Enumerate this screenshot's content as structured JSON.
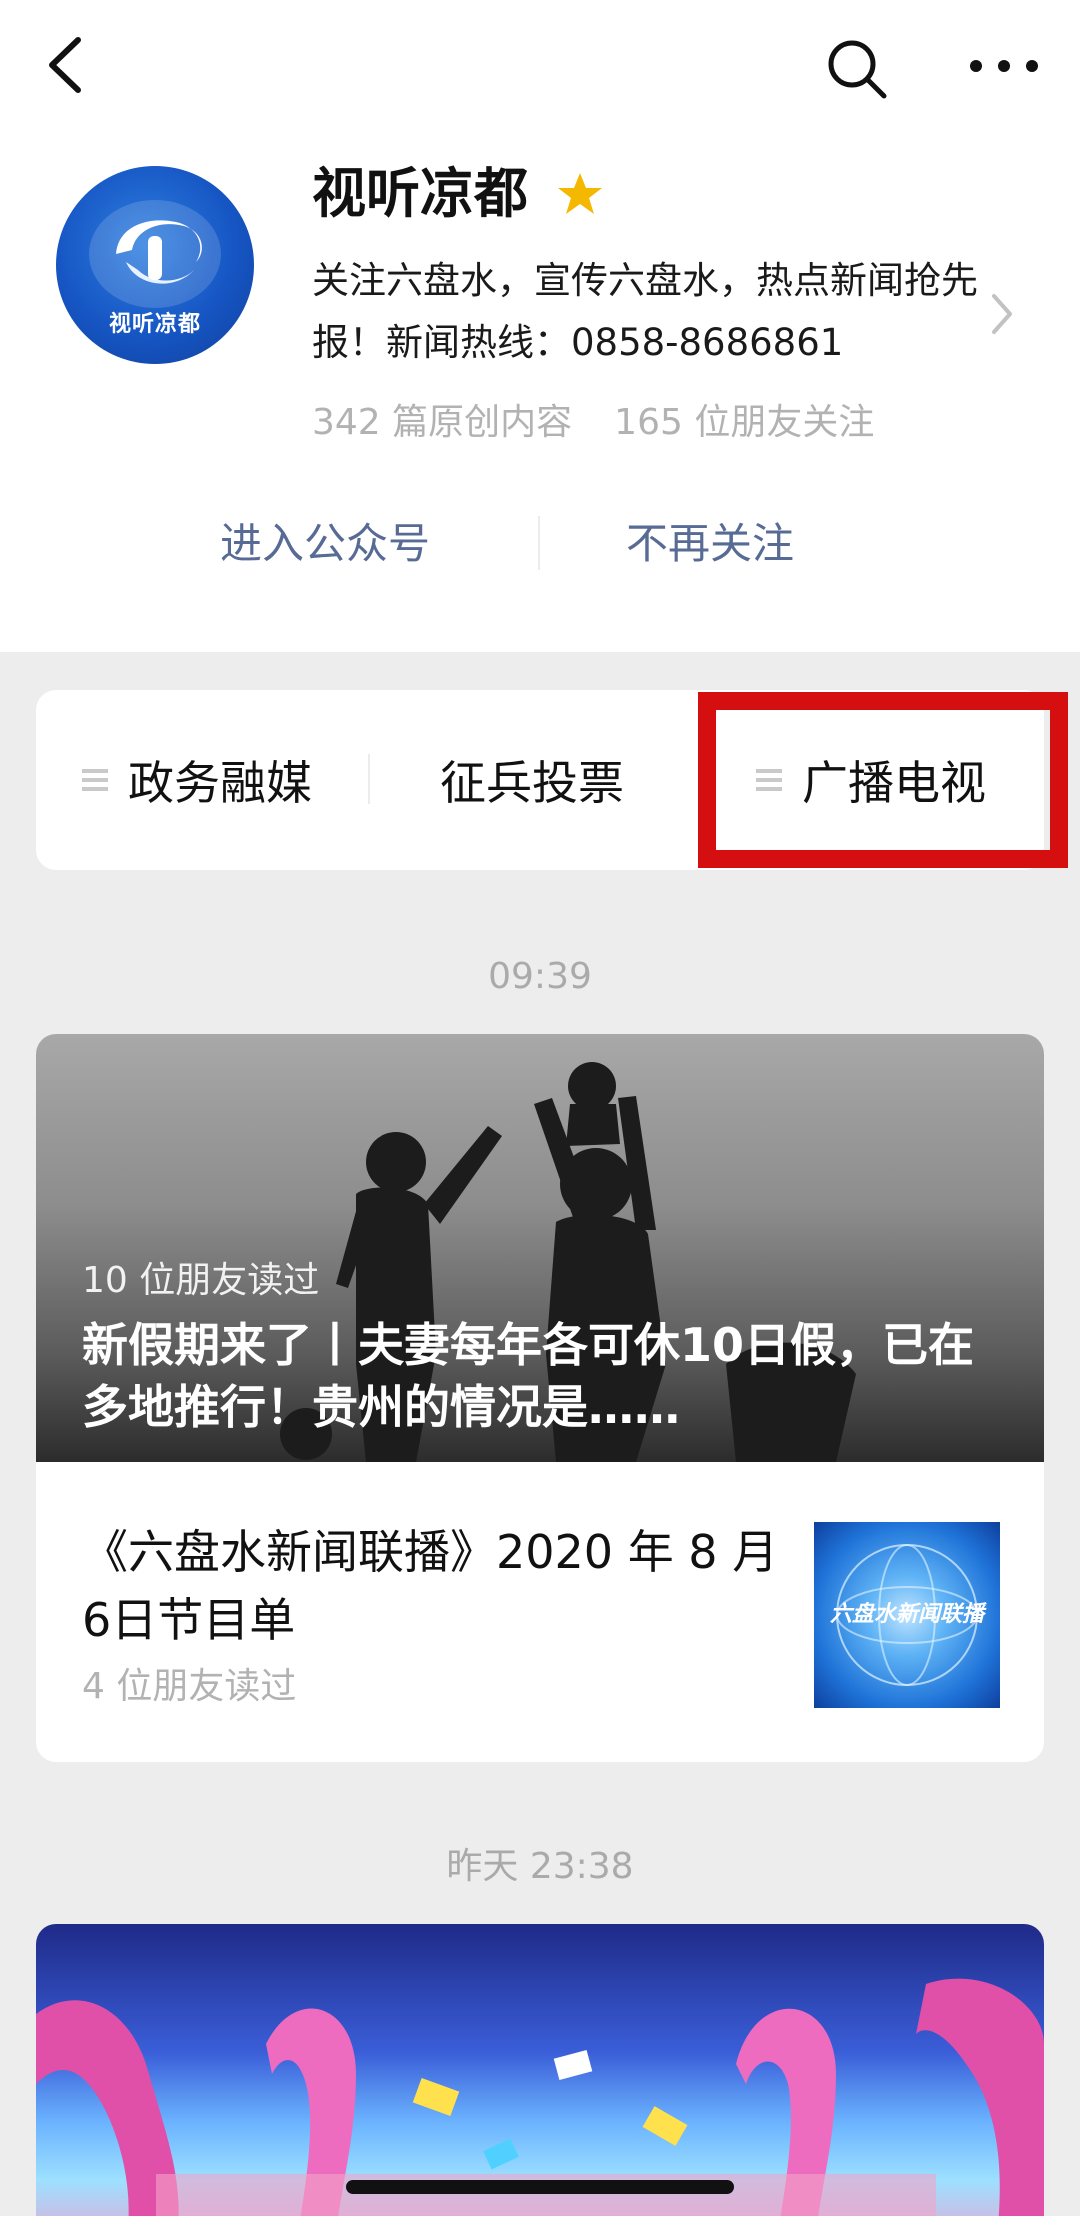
{
  "account": {
    "name": "视听凉都",
    "avatar_text": "视听凉都",
    "description": "关注六盘水，宣传六盘水，热点新闻抢先报！新闻热线：0858-8686861",
    "original_count": "342 篇原创内容",
    "followers": "165 位朋友关注"
  },
  "actions": {
    "enter": "进入公众号",
    "unfollow": "不再关注"
  },
  "menu": {
    "items": [
      {
        "label": "政务融媒"
      },
      {
        "label": "征兵投票"
      },
      {
        "label": "广播电视"
      }
    ],
    "highlight_color": "#d50f0f"
  },
  "feed": {
    "timestamp1": "09:39",
    "timestamp2": "昨天 23:38",
    "article1": {
      "readers": "10 位朋友读过",
      "title": "新假期来了丨夫妻每年各可休10日假，已在多地推行！贵州的情况是……"
    },
    "article2": {
      "title": "《六盘水新闻联播》2020 年 8 月6日节目单",
      "readers": "4 位朋友读过",
      "thumb_text": "六盘水新闻联播"
    }
  },
  "icons": {
    "back": "back-arrow-icon",
    "search": "search-icon",
    "more": "more-icon",
    "star": "star-icon",
    "chevron": "chevron-right-icon",
    "menu_list": "list-icon"
  },
  "colors": {
    "link": "#576b95",
    "star": "#f5b800",
    "background": "#ededed"
  }
}
